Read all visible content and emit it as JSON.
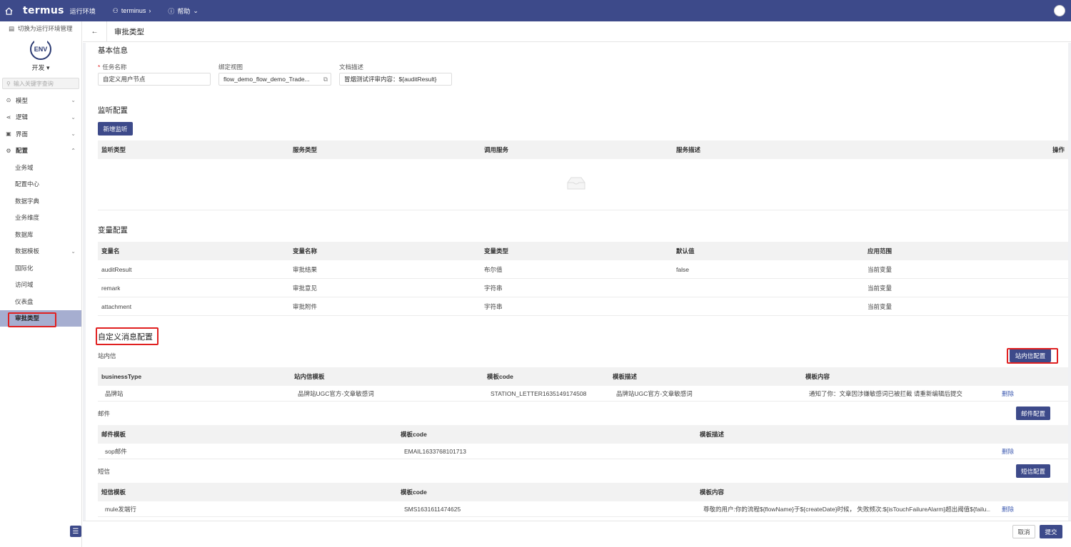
{
  "topbar": {
    "logo": "termus",
    "env_label": "运行环境",
    "breadcrumb": "terminus",
    "help": "帮助"
  },
  "sidebar": {
    "switch_label": "切换为运行环境管理",
    "env_name": "ENV",
    "env_select": "开发",
    "search_placeholder": "输入关键字查询",
    "menu": {
      "model": "模型",
      "logic": "逻辑",
      "ui": "界面",
      "config": "配置"
    },
    "sub": {
      "business_domain": "业务域",
      "config_center": "配置中心",
      "data_dict": "数据字典",
      "business_dimension": "业务维度",
      "database": "数据库",
      "data_template": "数据模板",
      "i18n": "国际化",
      "access_domain": "访问域",
      "dashboard": "仪表盘",
      "approval_type": "审批类型"
    }
  },
  "header": {
    "back": "←",
    "title": "审批类型"
  },
  "basic": {
    "title": "基本信息",
    "task_name_label": "任务名称",
    "task_name_value": "自定义用户节点",
    "bind_view_label": "绑定视图",
    "bind_view_value": "flow_demo_flow_demo_Trade...",
    "doc_desc_label": "文档描述",
    "doc_desc_value": "冒烟测试评审内容：${auditResult}"
  },
  "listener": {
    "title": "监听配置",
    "add_button": "新增监听",
    "columns": [
      "监听类型",
      "服务类型",
      "调用服务",
      "服务描述",
      "操作"
    ]
  },
  "variables": {
    "title": "变量配置",
    "columns": [
      "变量名",
      "变量名称",
      "变量类型",
      "默认值",
      "应用范围"
    ],
    "rows": [
      [
        "auditResult",
        "审批结果",
        "布尔值",
        "false",
        "当前变量"
      ],
      [
        "remark",
        "审批意见",
        "字符串",
        "",
        "当前变量"
      ],
      [
        "attachment",
        "审批附件",
        "字符串",
        "",
        "当前变量"
      ]
    ]
  },
  "custom_msg": {
    "title": "自定义消息配置",
    "station": {
      "label": "站内信",
      "button": "站内信配置",
      "columns": [
        "businessType",
        "站内信模板",
        "模板code",
        "模板描述",
        "模板内容"
      ],
      "row": [
        "品牌站",
        "品牌站UGC官方-文章敏感词",
        "STATION_LETTER1635149174508",
        "品牌站UGC官方-文章敏感词",
        "通知了你：文章因涉嫌敏感词已被拦截 请重新编辑后提交",
        "删除"
      ]
    },
    "email": {
      "label": "邮件",
      "button": "邮件配置",
      "columns": [
        "邮件模板",
        "模板code",
        "模板描述"
      ],
      "row": [
        "sop邮件",
        "EMAIL1633768101713",
        "",
        "删除"
      ]
    },
    "sms": {
      "label": "短信",
      "button": "短信配置",
      "columns": [
        "短信模板",
        "模板code",
        "模板内容"
      ],
      "row": [
        "mule发端行",
        "SMS1631611474625",
        "尊敬的用户:你的流程${flowName}于${createDate}时候， 失败频次:${isTouchFailureAlarm}超出阈值${failu...",
        "删除"
      ]
    }
  },
  "footer": {
    "cancel": "取消",
    "submit": "提交"
  },
  "colors": {
    "primary": "#3d4a8a",
    "highlight": "#e02020",
    "active_menu": "#a6aed0"
  }
}
